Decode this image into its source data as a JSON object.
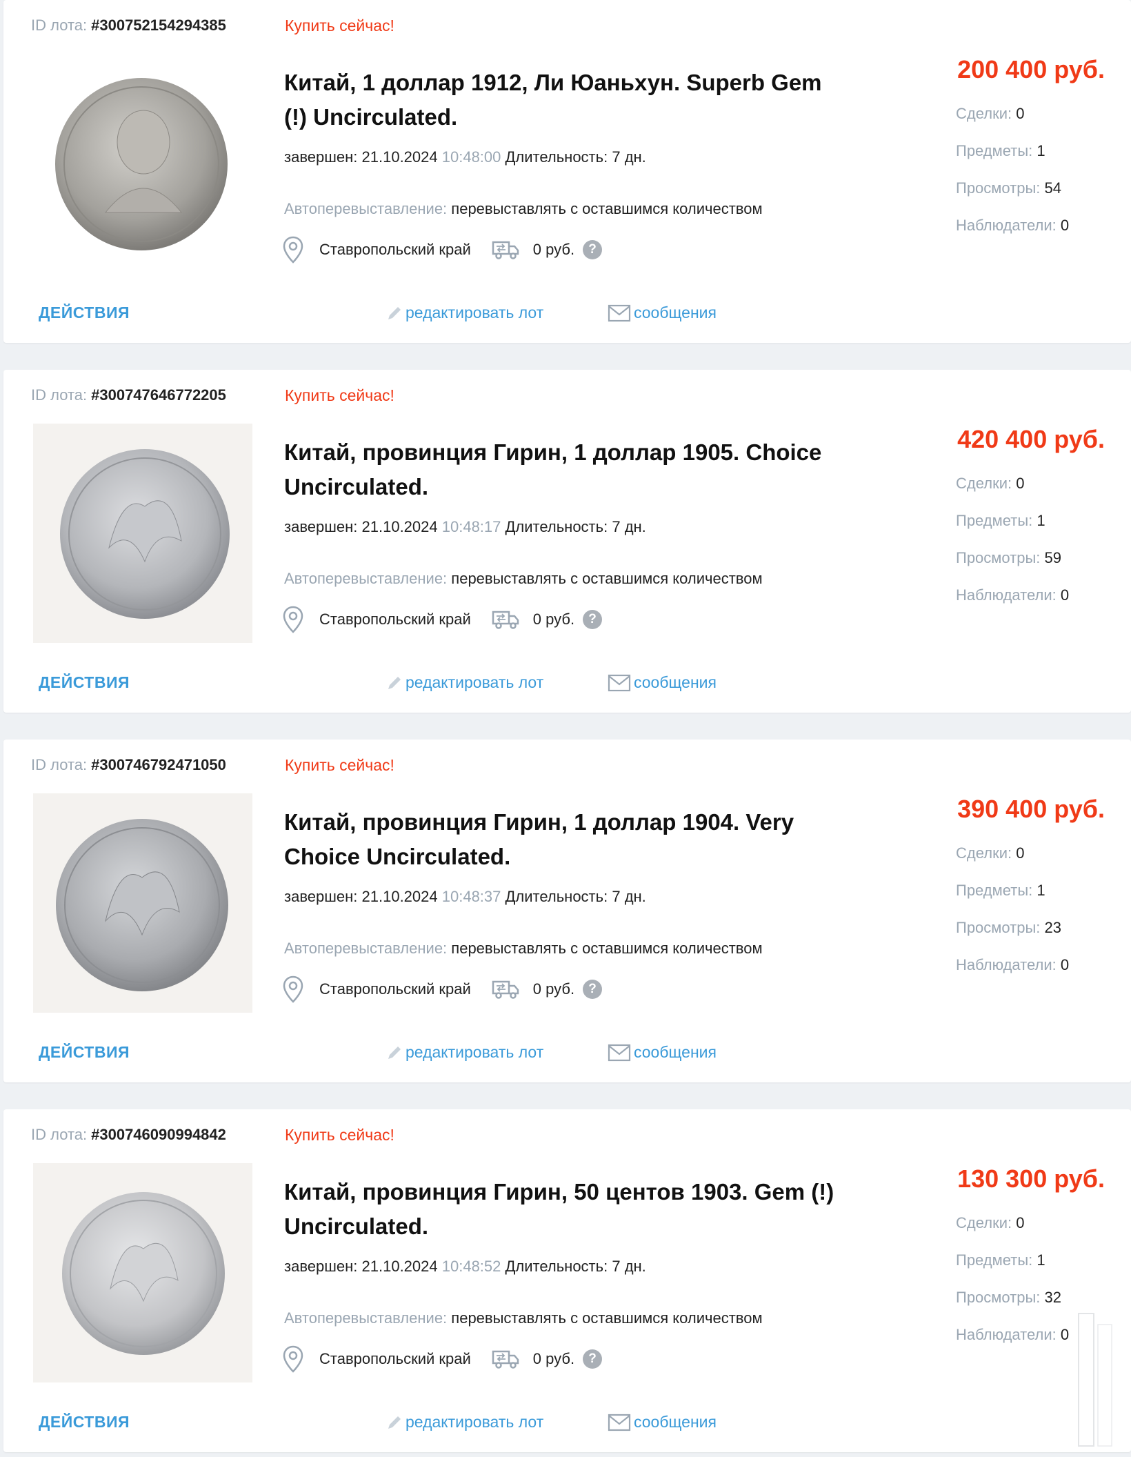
{
  "labels": {
    "id_prefix": "ID лота:",
    "buy_now": "Купить сейчас!",
    "ended": "завершен:",
    "duration": "Длительность:",
    "relist_label": "Автоперевыставление:",
    "deals": "Сделки:",
    "items": "Предметы:",
    "views": "Просмотры:",
    "watchers": "Наблюдатели:",
    "actions": "ДЕЙСТВИЯ",
    "edit_lot": "редактировать лот",
    "messages": "сообщения"
  },
  "icons": {
    "location": "map-pin-icon",
    "delivery": "delivery-truck-icon",
    "help": "question-circle-icon",
    "edit": "pencil-icon",
    "messages": "envelope-icon"
  },
  "colors": {
    "accent_red": "#f03a17",
    "link_blue": "#3a9ad9",
    "muted_gray": "#9aa6b2"
  },
  "lots": [
    {
      "id": "#300752154294385",
      "title": "Китай, 1 доллар 1912, Ли Юаньхун. Superb Gem (!) Uncirculated.",
      "date": "21.10.2024",
      "time": "10:48:00",
      "duration": "7 дн.",
      "relist_value": "перевыставлять с оставшимся количеством",
      "location": "Ставропольский край",
      "shipping": "0 руб.",
      "price": "200 400 руб.",
      "deals": "0",
      "items": "1",
      "views": "54",
      "watchers": "0"
    },
    {
      "id": "#300747646772205",
      "title": "Китай, провинция Гирин, 1 доллар 1905. Choice Uncirculated.",
      "date": "21.10.2024",
      "time": "10:48:17",
      "duration": "7 дн.",
      "relist_value": "перевыставлять с оставшимся количеством",
      "location": "Ставропольский край",
      "shipping": "0 руб.",
      "price": "420 400 руб.",
      "deals": "0",
      "items": "1",
      "views": "59",
      "watchers": "0"
    },
    {
      "id": "#300746792471050",
      "title": "Китай, провинция Гирин, 1 доллар 1904. Very Choice Uncirculated.",
      "date": "21.10.2024",
      "time": "10:48:37",
      "duration": "7 дн.",
      "relist_value": "перевыставлять с оставшимся количеством",
      "location": "Ставропольский край",
      "shipping": "0 руб.",
      "price": "390 400 руб.",
      "deals": "0",
      "items": "1",
      "views": "23",
      "watchers": "0"
    },
    {
      "id": "#300746090994842",
      "title": "Китай, провинция Гирин, 50 центов 1903. Gem (!) Uncirculated.",
      "date": "21.10.2024",
      "time": "10:48:52",
      "duration": "7 дн.",
      "relist_value": "перевыставлять с оставшимся количеством",
      "location": "Ставропольский край",
      "shipping": "0 руб.",
      "price": "130 300 руб.",
      "deals": "0",
      "items": "1",
      "views": "32",
      "watchers": "0"
    }
  ]
}
